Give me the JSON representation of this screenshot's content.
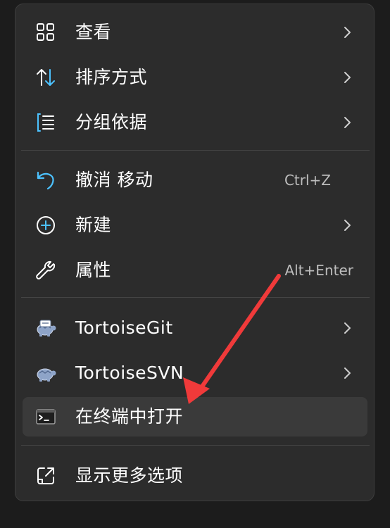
{
  "menu": {
    "group1": [
      {
        "label": "查看",
        "icon": "grid-icon"
      },
      {
        "label": "排序方式",
        "icon": "sort-icon"
      },
      {
        "label": "分组依据",
        "icon": "group-list-icon"
      }
    ],
    "undo": {
      "label": "撤消 移动",
      "shortcut": "Ctrl+Z",
      "icon": "undo-icon"
    },
    "new": {
      "label": "新建",
      "icon": "plus-circle-icon"
    },
    "properties": {
      "label": "属性",
      "shortcut": "Alt+Enter",
      "icon": "wrench-icon"
    },
    "tortoise_git": {
      "label": "TortoiseGit",
      "icon": "tortoisegit-icon"
    },
    "tortoise_svn": {
      "label": "TortoiseSVN",
      "icon": "tortoisesvn-icon"
    },
    "terminal": {
      "label": "在终端中打开",
      "icon": "terminal-icon"
    },
    "more": {
      "label": "显示更多选项",
      "icon": "open-external-icon"
    }
  },
  "colors": {
    "menu_bg": "#2c2c2c",
    "hover_bg": "#3a3a3a",
    "accent_blue": "#4cc2ff",
    "annotation_red": "#f03a3a"
  }
}
